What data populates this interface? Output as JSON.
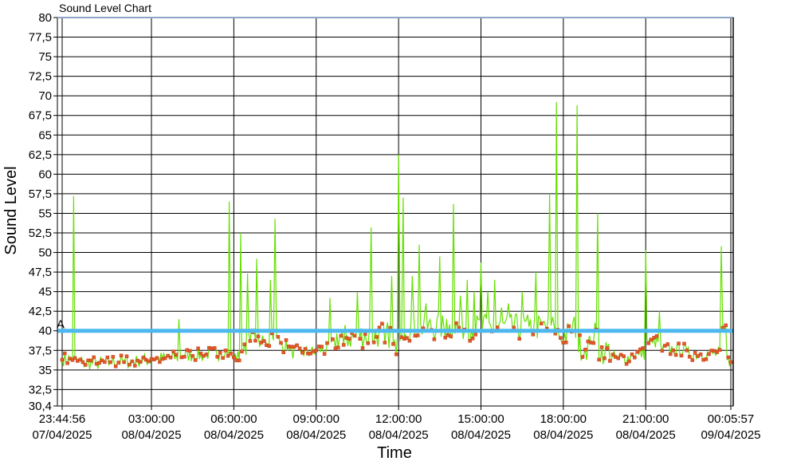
{
  "window": {
    "title": "Sound Level Chart"
  },
  "chart_data": {
    "type": "line",
    "title": "Sound Level Chart",
    "xlabel": "Time",
    "ylabel": "Sound Level",
    "ylim": [
      30.4,
      80
    ],
    "xlim": [
      "07/04/2025 23:44:56",
      "09/04/2025 00:05:57"
    ],
    "y_ticks": [
      "30,4",
      "32,5",
      "35",
      "37,5",
      "40",
      "42,5",
      "45",
      "47,5",
      "50",
      "52,5",
      "55",
      "57,5",
      "60",
      "62,5",
      "65",
      "67,5",
      "70",
      "72,5",
      "75",
      "77,5",
      "80"
    ],
    "x_ticks": [
      {
        "time": "23:44:56",
        "date": "07/04/2025"
      },
      {
        "time": "03:00:00",
        "date": "08/04/2025"
      },
      {
        "time": "06:00:00",
        "date": "08/04/2025"
      },
      {
        "time": "09:00:00",
        "date": "08/04/2025"
      },
      {
        "time": "12:00:00",
        "date": "08/04/2025"
      },
      {
        "time": "15:00:00",
        "date": "08/04/2025"
      },
      {
        "time": "18:00:00",
        "date": "08/04/2025"
      },
      {
        "time": "21:00:00",
        "date": "08/04/2025"
      },
      {
        "time": "00:05:57",
        "date": "09/04/2025"
      }
    ],
    "grid": true,
    "threshold": {
      "label": "A",
      "value": 40,
      "color": "#4db8f0"
    },
    "colors": {
      "line": "#66e000",
      "marker": "#e05a2a",
      "marker_stroke": "#c63c14"
    },
    "series": [
      {
        "x": [
          "23:45",
          "00:05",
          "00:10",
          "00:30",
          "01:00",
          "01:30",
          "02:00",
          "02:30",
          "03:00",
          "03:30",
          "04:00",
          "04:30",
          "05:00",
          "05:30",
          "05:45",
          "05:50",
          "06:00",
          "06:15",
          "06:20",
          "06:30",
          "06:50",
          "07:00",
          "07:20",
          "07:30",
          "07:40",
          "08:00",
          "08:30",
          "09:00",
          "09:30",
          "10:00",
          "10:30",
          "10:50",
          "11:00",
          "11:30",
          "11:45",
          "11:55",
          "12:00",
          "12:10",
          "12:15",
          "12:30",
          "12:45",
          "13:00",
          "13:30",
          "13:45",
          "14:00",
          "14:15",
          "14:30",
          "14:45",
          "15:00",
          "15:15",
          "15:30",
          "15:45",
          "16:00",
          "16:30",
          "16:45",
          "17:00",
          "17:15",
          "17:30",
          "17:40",
          "17:45",
          "18:00",
          "18:15",
          "18:30",
          "18:45",
          "19:00",
          "19:15",
          "19:30",
          "20:00",
          "20:30",
          "20:45",
          "21:00",
          "21:15",
          "21:30",
          "22:00",
          "22:30",
          "23:00",
          "23:45",
          "23:55",
          "00:05"
        ],
        "values": [
          36.3,
          36.5,
          57.2,
          36.0,
          35.8,
          36.0,
          36.0,
          36.2,
          36.4,
          36.5,
          41.5,
          36.8,
          37.0,
          37.2,
          37.2,
          56.5,
          36.6,
          52.5,
          37.5,
          47.3,
          49.2,
          38.5,
          46.5,
          54.3,
          38.8,
          38.0,
          37.2,
          37.5,
          44.2,
          38.2,
          45.0,
          38.5,
          53.2,
          38.5,
          47.0,
          37.0,
          62.5,
          57.0,
          39.5,
          47.0,
          51.0,
          43.5,
          49.5,
          41.5,
          56.2,
          44.5,
          46.5,
          45.0,
          48.7,
          45.0,
          46.5,
          43.0,
          43.5,
          45.0,
          40.5,
          47.5,
          41.0,
          57.5,
          40.5,
          69.2,
          38.5,
          40.0,
          68.8,
          37.0,
          38.5,
          55.0,
          36.5,
          36.5,
          37.0,
          37.0,
          50.3,
          38.5,
          42.5,
          37.5,
          37.5,
          37.0,
          50.8,
          40.7,
          36.0
        ]
      }
    ]
  }
}
